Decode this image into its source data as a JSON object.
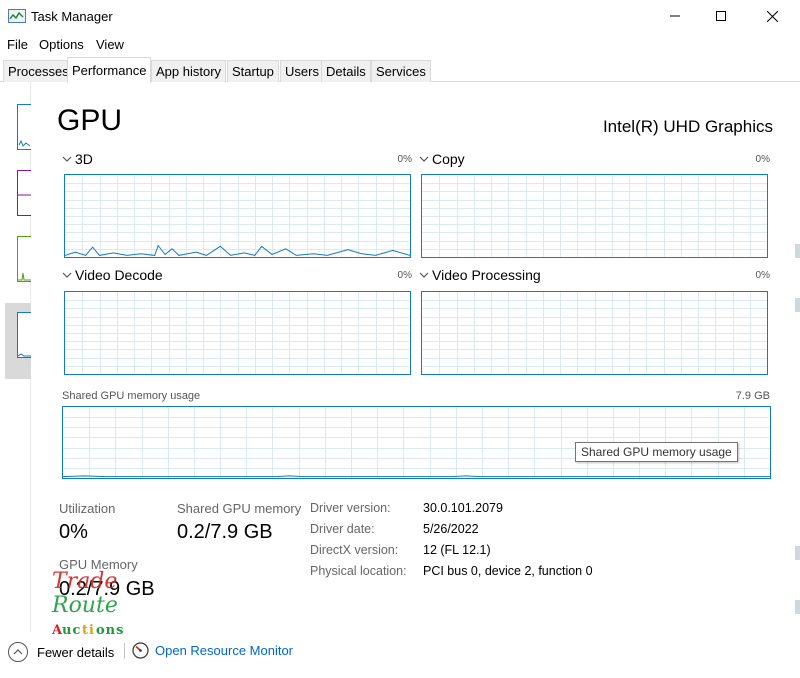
{
  "window": {
    "title": "Task Manager"
  },
  "menu": [
    "File",
    "Options",
    "View"
  ],
  "tabs": [
    "Processes",
    "Performance",
    "App history",
    "Startup",
    "Users",
    "Details",
    "Services"
  ],
  "active_tab": "Performance",
  "gpu": {
    "heading": "GPU",
    "model": "Intel(R) UHD Graphics"
  },
  "graphs": {
    "g3d": {
      "label": "3D",
      "pct": "0%"
    },
    "copy": {
      "label": "Copy",
      "pct": "0%"
    },
    "decode": {
      "label": "Video Decode",
      "pct": "0%"
    },
    "processing": {
      "label": "Video Processing",
      "pct": "0%"
    }
  },
  "shared_memory": {
    "label": "Shared GPU memory usage",
    "max": "7.9 GB",
    "tooltip": "Shared GPU memory usage"
  },
  "stats": {
    "utilization_label": "Utilization",
    "utilization_value": "0%",
    "shared_label": "Shared GPU memory",
    "shared_value": "0.2/7.9 GB",
    "gpu_memory_label": "GPU Memory",
    "gpu_memory_value": "0.2/7.9 GB"
  },
  "details": [
    {
      "label": "Driver version:",
      "value": "30.0.101.2079"
    },
    {
      "label": "Driver date:",
      "value": "5/26/2022"
    },
    {
      "label": "DirectX version:",
      "value": "12 (FL 12.1)"
    },
    {
      "label": "Physical location:",
      "value": "PCI bus 0, device 2, function 0"
    }
  ],
  "watermark": {
    "line1": "Trade",
    "line2": "Route",
    "line3": "Auctions"
  },
  "bottom": {
    "fewer_details": "Fewer details",
    "resource_monitor": "Open Resource Monitor"
  },
  "colors": {
    "accent": "#117dbb",
    "link": "#0066cc",
    "grid": "#d9eaf4"
  }
}
